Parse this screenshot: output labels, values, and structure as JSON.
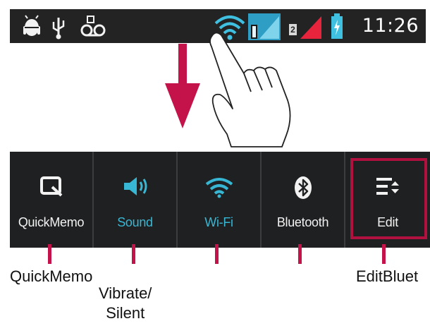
{
  "status_bar": {
    "time": "11:26",
    "sim_slot_label": "2",
    "left_icons": [
      "android-bug-icon",
      "usb-icon",
      "voicemail-icon"
    ],
    "right_icons": [
      "wifi-icon",
      "sim1-signal-icon",
      "sim2-signal-icon",
      "battery-icon"
    ],
    "colors": {
      "background": "#232323",
      "wifi": "#3fc0e0",
      "sim2_signal": "#e8243c",
      "battery": "#3fc0e0"
    }
  },
  "gesture": {
    "icons": [
      "swipe-down-arrow-icon",
      "pointing-hand-icon"
    ],
    "arrow_color": "#c4134a"
  },
  "quick_settings": {
    "tiles": [
      {
        "label": "QuickMemo",
        "icon": "quickmemo-icon",
        "active": false
      },
      {
        "label": "Sound",
        "icon": "speaker-icon",
        "active": true
      },
      {
        "label": "Wi-Fi",
        "icon": "wifi-icon",
        "active": true
      },
      {
        "label": "Bluetooth",
        "icon": "bluetooth-icon",
        "active": false
      },
      {
        "label": "Edit",
        "icon": "edit-list-icon",
        "active": false
      }
    ],
    "colors": {
      "background": "#1f2021",
      "active_label": "#38b7d4",
      "inactive_label": "#f2f2f2",
      "edit_highlight": "#b0113f"
    }
  },
  "callouts": {
    "quickmemo": "QuickMemo",
    "vibrate_silent": "Vibrate/\nSilent",
    "edit_bluetooth": "EditBluet"
  }
}
